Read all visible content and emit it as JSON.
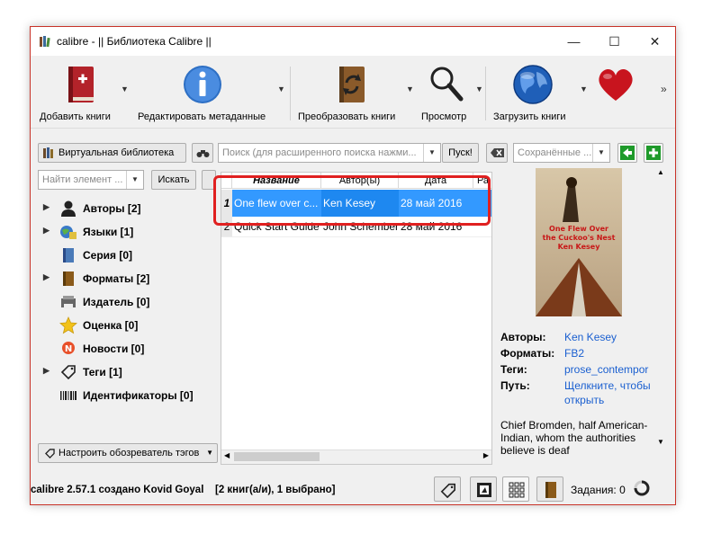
{
  "window": {
    "title": "calibre - || Библиотека Calibre ||",
    "minimize": "—",
    "maximize": "☐",
    "close": "✕"
  },
  "toolbar": {
    "add_books": "Добавить книги",
    "edit_metadata": "Редактировать метаданные",
    "convert_books": "Преобразовать книги",
    "view": "Просмотр",
    "get_books": "Загрузить книги",
    "more": "»"
  },
  "search_bar": {
    "virtual_library": "Виртуальная библиотека",
    "search_placeholder": "Поиск (для расширенного поиска нажми...",
    "search_button": "Пуск!",
    "saved_searches_placeholder": "Сохранённые ..."
  },
  "tag_browser": {
    "find_placeholder": "Найти элемент ...",
    "find_button": "Искать",
    "items": [
      {
        "label": "Авторы [2]",
        "expandable": true
      },
      {
        "label": "Языки [1]",
        "expandable": true
      },
      {
        "label": "Серия [0]",
        "expandable": false
      },
      {
        "label": "Форматы [2]",
        "expandable": true
      },
      {
        "label": "Издатель [0]",
        "expandable": false
      },
      {
        "label": "Оценка [0]",
        "expandable": false
      },
      {
        "label": "Новости [0]",
        "expandable": false
      },
      {
        "label": "Теги [1]",
        "expandable": true
      },
      {
        "label": "Идентификаторы [0]",
        "expandable": false
      }
    ],
    "configure_button": "Настроить обозреватель тэгов"
  },
  "book_list": {
    "columns": [
      "Название",
      "Автор(ы)",
      "Дата",
      "Ра"
    ],
    "rows": [
      {
        "num": "1",
        "title": "One flew over c...",
        "author": "Ken Kesey",
        "date": "28 май 2016",
        "selected": true
      },
      {
        "num": "2",
        "title": "Quick Start Guide",
        "author": "John Schember",
        "date": "28 май 2016",
        "selected": false
      }
    ]
  },
  "cover": {
    "title_text": "One Flew Over the Cuckoo's Nest",
    "author_text": "Ken Kesey"
  },
  "book_details": {
    "authors_label": "Авторы:",
    "authors_value": "Ken Kesey",
    "formats_label": "Форматы:",
    "formats_value": "FB2",
    "tags_label": "Теги:",
    "tags_value": "prose_contempor",
    "path_label": "Путь:",
    "path_value_1": "Щелкните, чтобы",
    "path_value_2": "открыть",
    "description": "Chief Bromden, half American-Indian, whom the authorities believe is deaf"
  },
  "status_bar": {
    "version_text": "calibre 2.57.1 создано Kovid Goyal",
    "count_text": "[2 книг(а/и), 1 выбрано]",
    "jobs_text": "Задания: 0"
  },
  "colors": {
    "selection": "#3399ff",
    "highlight_border": "#e02020",
    "link": "#1a5fd0",
    "window_border": "#c83228"
  }
}
